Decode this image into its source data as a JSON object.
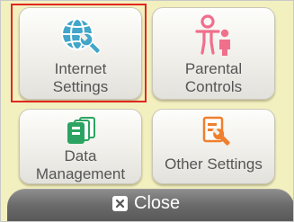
{
  "menu": {
    "internet": {
      "line1": "Internet",
      "line2": "Settings",
      "icon": "globe-wrench-icon",
      "color": "#41a6c9"
    },
    "parental": {
      "line1": "Parental",
      "line2": "Controls",
      "icon": "parent-child-icon",
      "color": "#f06f8c"
    },
    "data": {
      "line1": "Data",
      "line2": "Management",
      "icon": "data-cards-icon",
      "color": "#2ca461"
    },
    "other": {
      "line1": "Other Settings",
      "icon": "document-wrench-icon",
      "color": "#ef7f2c"
    },
    "selected": "internet",
    "selection_color": "#e0281e"
  },
  "footer": {
    "close_label": "Close",
    "close_icon": "x-box-icon"
  },
  "colors": {
    "background": "#f3f0c0",
    "button_text": "#555555",
    "footer_bar": "#6a6a6a"
  }
}
